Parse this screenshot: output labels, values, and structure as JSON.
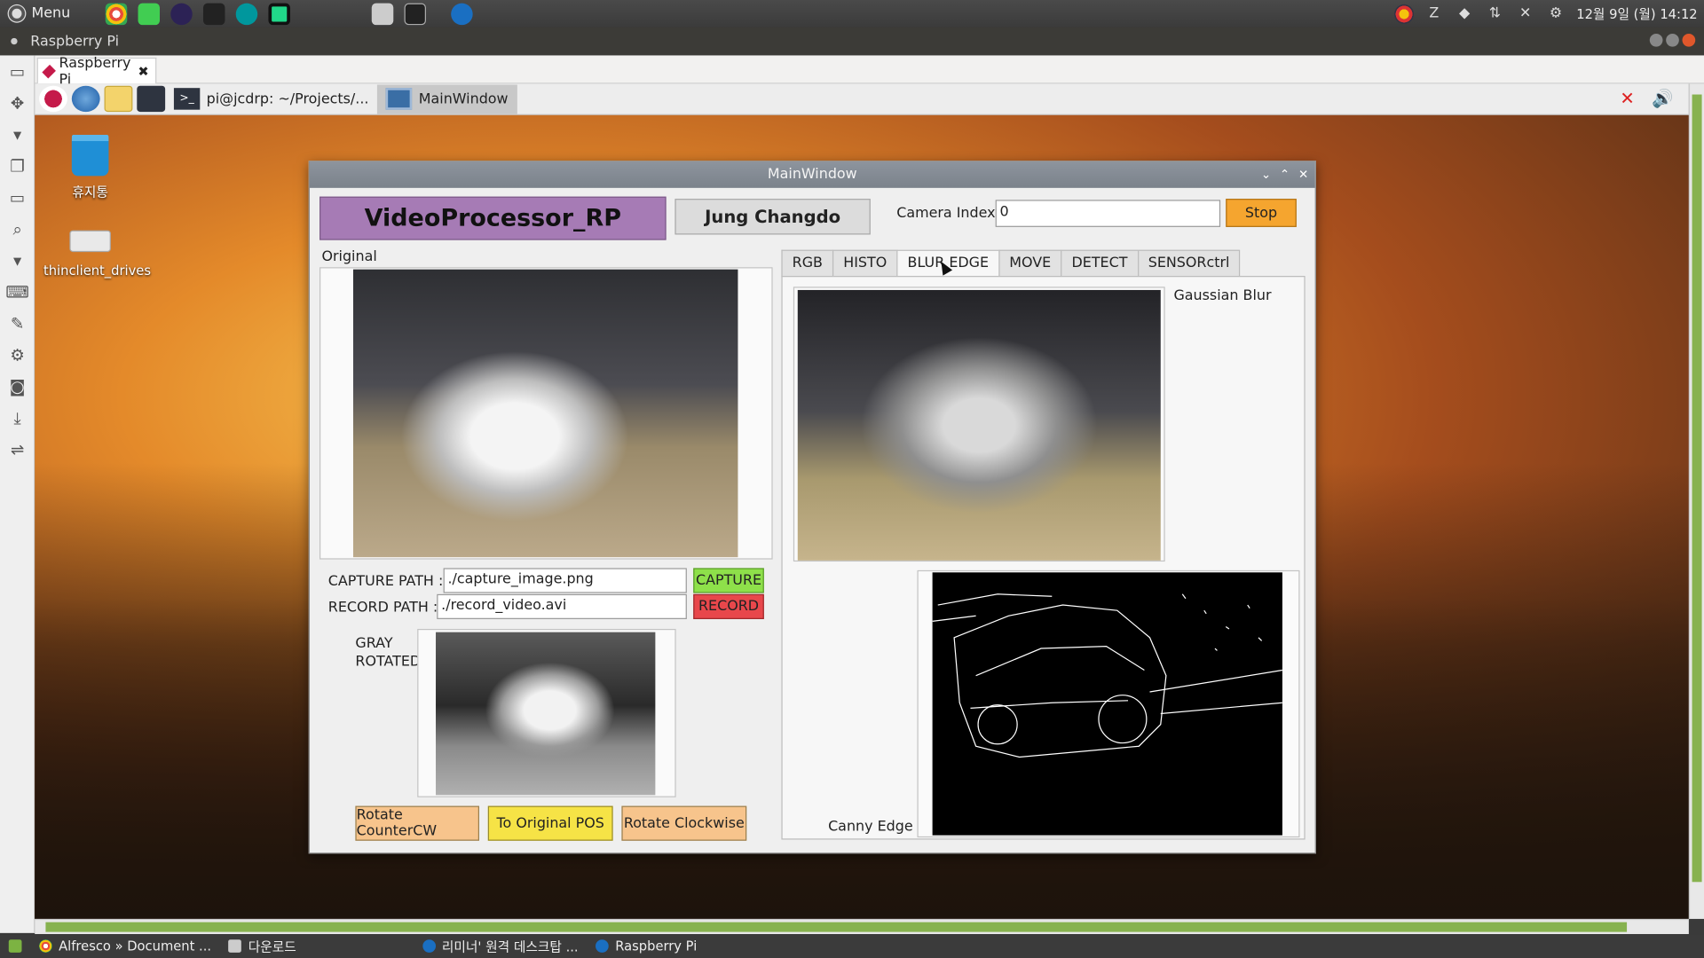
{
  "host_panel": {
    "menu_label": "Menu",
    "clock": "12월 9일 (월) 14:12"
  },
  "remote_window": {
    "title": "Raspberry Pi",
    "tab_label": "Raspberry Pi"
  },
  "remote_panel": {
    "tasks": [
      {
        "label": "pi@jcdrp: ~/Projects/..."
      },
      {
        "label": "MainWindow"
      }
    ]
  },
  "desktop": {
    "icons": [
      {
        "label": "휴지통"
      },
      {
        "label": "thinclient_drives"
      }
    ]
  },
  "main_window": {
    "title": "MainWindow",
    "app_name": "VideoProcessor_RP",
    "author": "Jung Changdo",
    "camera_index_label": "Camera Index :",
    "camera_index_value": "0",
    "stop_label": "Stop",
    "original_label": "Original",
    "capture_path_label": "CAPTURE PATH :",
    "capture_path_value": "./capture_image.png",
    "capture_button": "CAPTURE",
    "record_path_label": "RECORD PATH :",
    "record_path_value": "./record_video.avi",
    "record_button": "RECORD",
    "gray_label_1": "GRAY",
    "gray_label_2": "ROTATED",
    "rotate_ccw": "Rotate CounterCW",
    "to_original": "To Original POS",
    "rotate_cw": "Rotate Clockwise",
    "tabs": [
      "RGB",
      "HISTO",
      "BLUR EDGE",
      "MOVE",
      "DETECT",
      "SENSORctrl"
    ],
    "active_tab": "BLUR EDGE",
    "blur_label": "Gaussian Blur",
    "edge_label": "Canny Edge"
  },
  "taskbar": {
    "items": [
      {
        "label": "Alfresco » Document ..."
      },
      {
        "label": "다운로드"
      },
      {
        "label": "리미너' 원격 데스크탑 ..."
      },
      {
        "label": "Raspberry Pi"
      }
    ]
  },
  "colors": {
    "app_name_bg": "#a67bb5",
    "stop_bg": "#f5a52f",
    "capture_bg": "#8ee04a",
    "record_bg": "#e8474b",
    "rotate_bg": "#f7c48c",
    "original_pos_bg": "#f6e346",
    "scroll_thumb": "#87b24f"
  }
}
